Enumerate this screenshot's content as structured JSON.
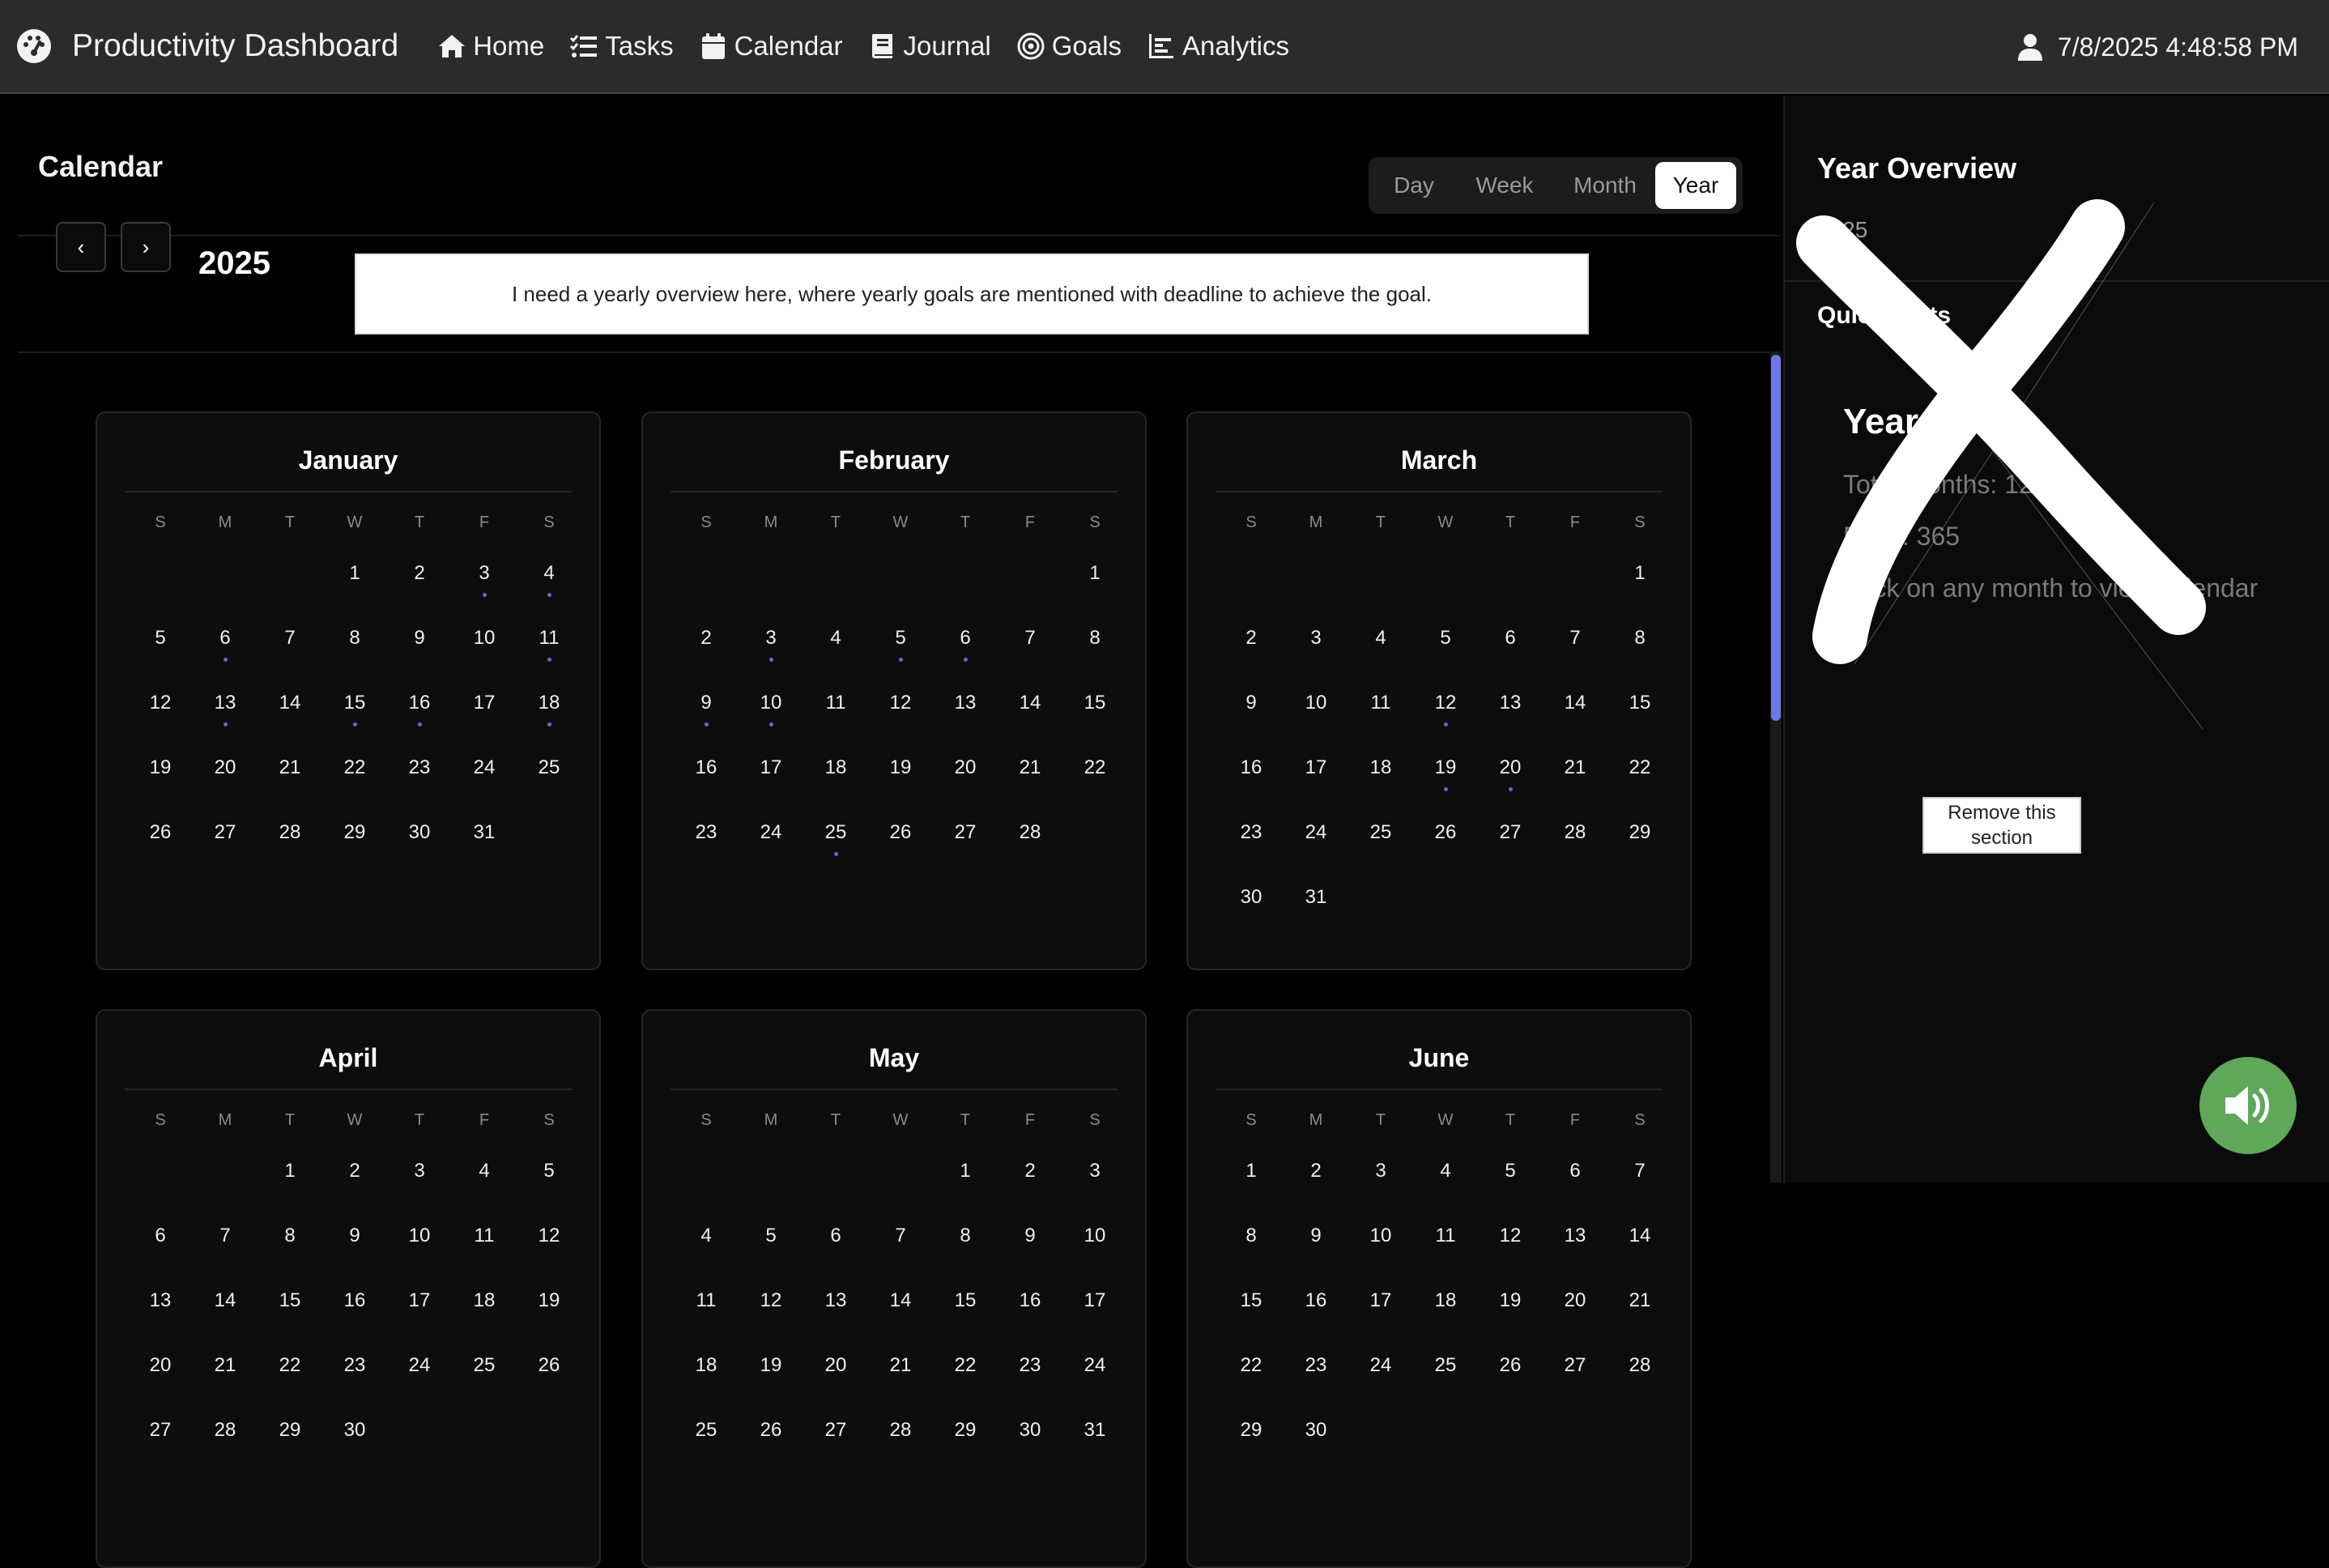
{
  "app": {
    "title": "Productivity Dashboard",
    "nav": [
      {
        "label": "Home",
        "icon": "home-icon"
      },
      {
        "label": "Tasks",
        "icon": "tasks-icon"
      },
      {
        "label": "Calendar",
        "icon": "calendar-icon"
      },
      {
        "label": "Journal",
        "icon": "journal-icon"
      },
      {
        "label": "Goals",
        "icon": "goals-icon"
      },
      {
        "label": "Analytics",
        "icon": "analytics-icon"
      }
    ],
    "datetime": "7/8/2025 4:48:58 PM"
  },
  "calendar": {
    "title": "Calendar",
    "views": [
      "Day",
      "Week",
      "Month",
      "Year"
    ],
    "active_view": "Year",
    "prev_label": "‹",
    "next_label": "›",
    "year": "2025",
    "note": "I need a yearly overview here, where yearly goals are mentioned with deadline to achieve the goal.",
    "weekdays": [
      "S",
      "M",
      "T",
      "W",
      "T",
      "F",
      "S"
    ],
    "months": [
      {
        "name": "January",
        "start": 3,
        "days": 31,
        "dots": [
          3,
          4,
          6,
          11,
          13,
          15,
          16,
          18
        ]
      },
      {
        "name": "February",
        "start": 6,
        "days": 28,
        "dots": [
          3,
          5,
          6,
          9,
          10,
          25
        ]
      },
      {
        "name": "March",
        "start": 6,
        "days": 31,
        "dots": [
          12,
          19,
          20
        ]
      },
      {
        "name": "April",
        "start": 2,
        "days": 30,
        "dots": []
      },
      {
        "name": "May",
        "start": 4,
        "days": 31,
        "dots": []
      },
      {
        "name": "June",
        "start": 0,
        "days": 30,
        "dots": []
      }
    ],
    "accent": "#6f78e6"
  },
  "side": {
    "overview_title": "Year Overview",
    "overview_sub": "2025",
    "quick_stats_title": "Quick Stats",
    "summary_title": "Year 2025",
    "total_months": "Total Months: 12",
    "days": "Days: 365",
    "hint": "Click on any month to view calendar",
    "remove_note": "Remove this section"
  },
  "sound_button_icon": "volume-icon",
  "colors": {
    "sound_button": "#5fa85a",
    "dot": "#5a6bd8"
  }
}
